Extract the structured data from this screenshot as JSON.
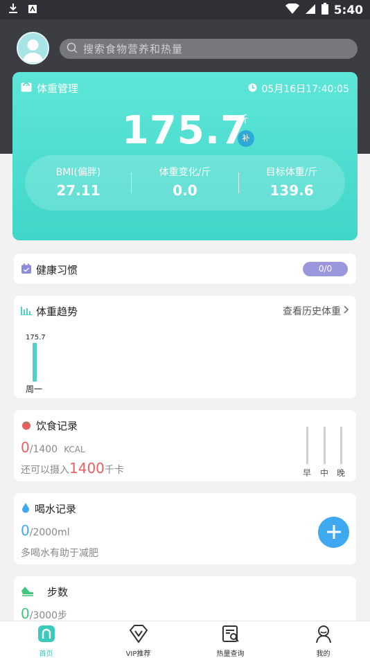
{
  "status_bar": {
    "time": "5:40"
  },
  "search": {
    "placeholder": "搜索食物营养和热量"
  },
  "weight_card": {
    "title": "体重管理",
    "datetime": "05月16日17:40:05",
    "weight": "175.7",
    "unit": "斤",
    "badge": "补",
    "stats": [
      {
        "label": "BMI(偏胖)",
        "value": "27.11"
      },
      {
        "label": "体重变化/斤",
        "value": "0.0"
      },
      {
        "label": "目标体重/斤",
        "value": "139.6"
      }
    ]
  },
  "habits": {
    "title": "健康习惯",
    "progress": "0/0"
  },
  "trend": {
    "title": "体重趋势",
    "link": "查看历史体重",
    "point_value": "175.7",
    "point_day": "周一"
  },
  "diet": {
    "title": "饮食记录",
    "current": "0",
    "target": "/1400",
    "unit": "KCAL",
    "remain_prefix": "还可以摄入",
    "remain_value": "1400",
    "remain_unit": "千卡",
    "meals": [
      "早",
      "中",
      "晚"
    ]
  },
  "water": {
    "title": "喝水记录",
    "current": "0",
    "target": "/2000ml",
    "tip": "多喝水有助于减肥"
  },
  "steps": {
    "title": "步数",
    "current": "0",
    "target": "/3000步"
  },
  "nav": [
    {
      "label": "首页"
    },
    {
      "label": "VIP推荐"
    },
    {
      "label": "热量查询"
    },
    {
      "label": "我的"
    }
  ],
  "colors": {
    "accent": "#4fd1c5",
    "diet_red": "#e8605f",
    "water_blue": "#3ea9ee",
    "steps_green": "#3cc77a",
    "habit_pill": "#9b97dd"
  }
}
